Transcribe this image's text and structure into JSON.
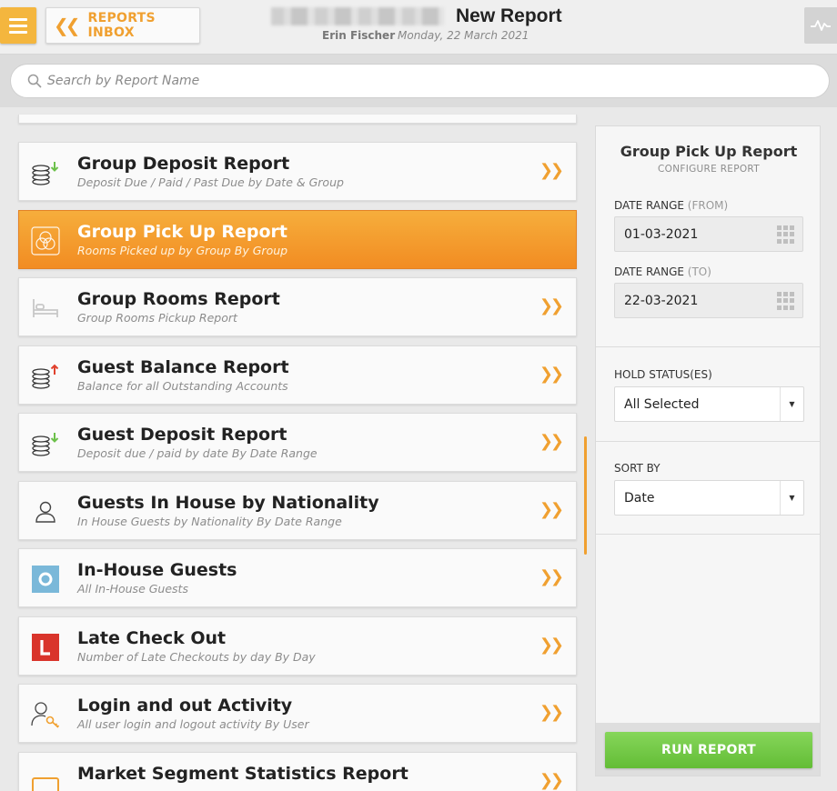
{
  "header": {
    "inbox_label": "REPORTS INBOX",
    "title": "New Report",
    "user": "Erin Fischer",
    "date": "Monday, 22 March 2021"
  },
  "search": {
    "placeholder": "Search by Report Name",
    "value": ""
  },
  "reports": [
    {
      "title": "Group Deposit Report",
      "subtitle": "Deposit Due / Paid / Past Due by Date & Group",
      "icon": "coins-down-icon",
      "active": false
    },
    {
      "title": "Group Pick Up Report",
      "subtitle": "Rooms Picked up by Group By Group",
      "icon": "group-circles-icon",
      "active": true
    },
    {
      "title": "Group Rooms Report",
      "subtitle": "Group Rooms Pickup Report",
      "icon": "bed-icon",
      "active": false
    },
    {
      "title": "Guest Balance Report",
      "subtitle": "Balance for all Outstanding Accounts",
      "icon": "coins-up-icon",
      "active": false
    },
    {
      "title": "Guest Deposit Report",
      "subtitle": "Deposit due / paid by date By Date Range",
      "icon": "coins-down-icon",
      "active": false
    },
    {
      "title": "Guests In House by Nationality",
      "subtitle": "In House Guests by Nationality By Date Range",
      "icon": "person-icon",
      "active": false
    },
    {
      "title": "In-House Guests",
      "subtitle": "All In-House Guests",
      "icon": "in-house-icon",
      "active": false
    },
    {
      "title": "Late Check Out",
      "subtitle": "Number of Late Checkouts by day By Day",
      "icon": "late-checkout-icon",
      "active": false
    },
    {
      "title": "Login and out Activity",
      "subtitle": "All user login and logout activity By User",
      "icon": "user-key-icon",
      "active": false
    },
    {
      "title": "Market Segment Statistics Report",
      "subtitle": "",
      "icon": "market-segment-icon",
      "active": false
    }
  ],
  "config": {
    "title": "Group Pick Up Report",
    "subtitle": "CONFIGURE REPORT",
    "date_from_label": "DATE RANGE",
    "date_from_hint": "(FROM)",
    "date_from_value": "01-03-2021",
    "date_to_label": "DATE RANGE",
    "date_to_hint": "(TO)",
    "date_to_value": "22-03-2021",
    "hold_label": "HOLD STATUS(ES)",
    "hold_value": "All Selected",
    "sort_label": "SORT BY",
    "sort_value": "Date",
    "run_label": "RUN REPORT"
  },
  "colors": {
    "accent": "#f0a030",
    "active_start": "#f6ae3c",
    "active_end": "#f28c22",
    "run_button": "#6cc53f"
  }
}
